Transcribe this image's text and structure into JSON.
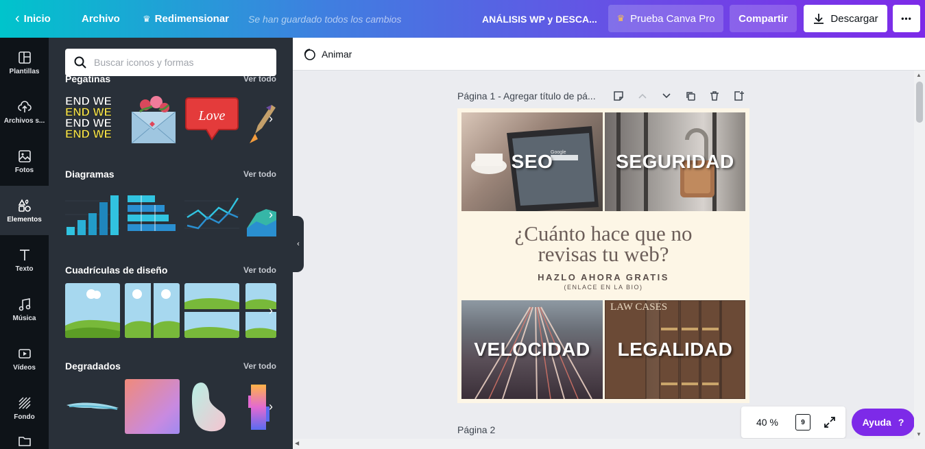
{
  "topbar": {
    "home": "Inicio",
    "file": "Archivo",
    "resize": "Redimensionar",
    "saved_status": "Se han guardado todos los cambios",
    "doc_title": "ANÁLISIS WP y DESCA...",
    "try_pro": "Prueba Canva Pro",
    "share": "Compartir",
    "download": "Descargar",
    "more": "•••"
  },
  "sidenav": {
    "items": [
      {
        "label": "Plantillas",
        "icon": "templates-icon"
      },
      {
        "label": "Archivos s...",
        "icon": "upload-icon"
      },
      {
        "label": "Fotos",
        "icon": "photos-icon"
      },
      {
        "label": "Elementos",
        "icon": "elements-icon"
      },
      {
        "label": "Texto",
        "icon": "text-icon"
      },
      {
        "label": "Música",
        "icon": "music-icon"
      },
      {
        "label": "Vídeos",
        "icon": "video-icon"
      },
      {
        "label": "Fondo",
        "icon": "background-icon"
      }
    ],
    "active": "Elementos"
  },
  "panel": {
    "search_placeholder": "Buscar iconos y formas",
    "see_all": "Ver todo",
    "sections": [
      {
        "title": "Pegatinas"
      },
      {
        "title": "Diagramas"
      },
      {
        "title": "Cuadrículas de diseño"
      },
      {
        "title": "Degradados"
      }
    ],
    "sticker_love": "Love",
    "sticker_weekend": "END WE"
  },
  "editor": {
    "animate": "Animar",
    "page1_header": "Página 1 - Agregar título de pá...",
    "page2_header": "Página 2",
    "zoom": "40 %",
    "pages_count": "9",
    "help": "Ayuda",
    "help_icon": "?"
  },
  "design": {
    "tiles": [
      "SEO",
      "SEGURIDAD",
      "VELOCIDAD",
      "LEGALIDAD"
    ],
    "question": "¿Cuánto hace que no revisas tu web?",
    "cta": "HAZLO AHORA GRATIS",
    "sub": "(ENLACE EN LA BIO)",
    "tablet_text": "Google",
    "book_text": "LAW CASES"
  },
  "colors": {
    "accent": "#7d2ae8",
    "sidebar_dark": "#0e1318",
    "panel": "#293039",
    "teal": "#00c4cc"
  }
}
